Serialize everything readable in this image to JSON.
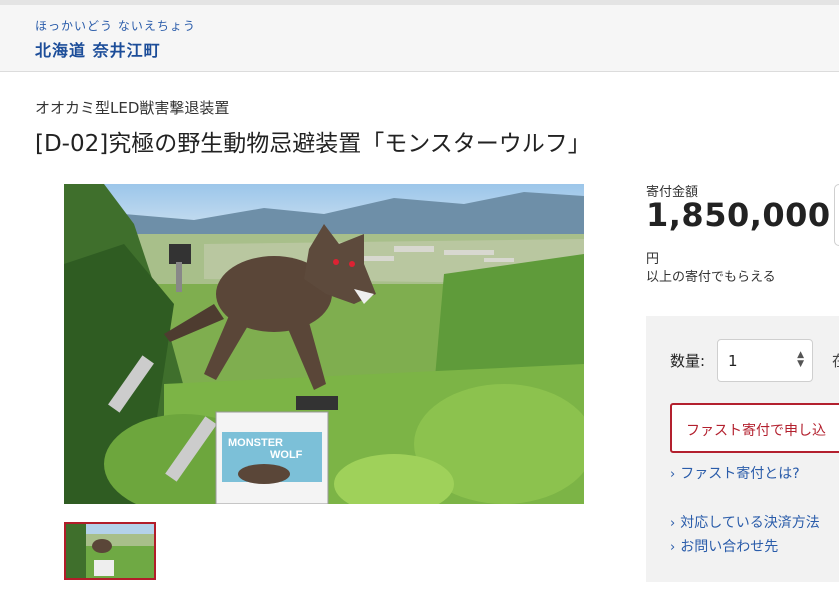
{
  "header": {
    "municipality_kana": "ほっかいどう ないえちょう",
    "municipality_name": "北海道 奈井江町"
  },
  "product": {
    "category": "オオカミ型LED獣害撃退装置",
    "title": "[D-02]究極の野生動物忌避装置「モンスターウルフ」",
    "image_sign_line1": "MONSTER",
    "image_sign_line2": "WOLF"
  },
  "donation": {
    "label": "寄付金額",
    "amount": "1,850,000",
    "unit": "円",
    "note": "以上の寄付でもらえる"
  },
  "order": {
    "quantity_label": "数量:",
    "quantity_value": "1",
    "quantity_trailing": "在",
    "fast_button_label": "ファスト寄付で申し込",
    "links": {
      "what_is_fast": "ファスト寄付とは?",
      "payment_methods": "対応している決済方法",
      "contact": "お問い合わせ先"
    }
  },
  "colors": {
    "brand_blue": "#1c4d99",
    "accent_red": "#b3202e",
    "panel_gray": "#f2f2f2"
  }
}
